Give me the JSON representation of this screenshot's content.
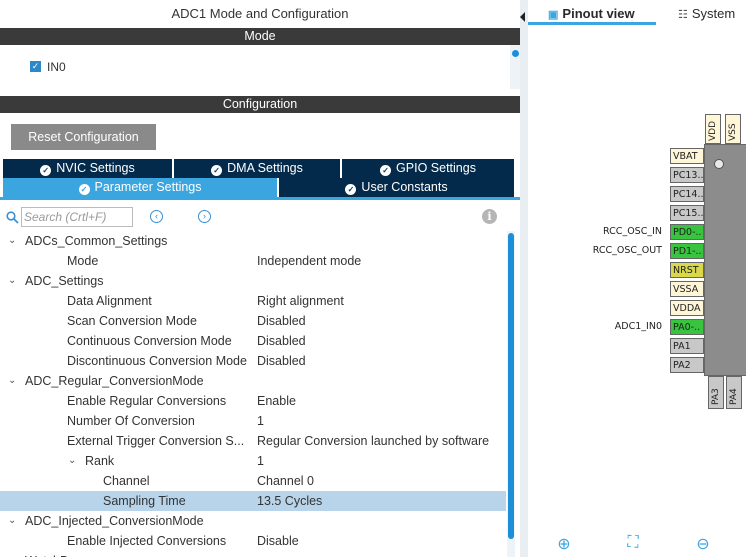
{
  "left": {
    "title": "ADC1 Mode and Configuration",
    "mode_header": "Mode",
    "mode_checkbox_label": "IN0",
    "config_header": "Configuration",
    "reset_button": "Reset Configuration",
    "tabs_row1": [
      "NVIC Settings",
      "DMA Settings",
      "GPIO Settings"
    ],
    "tabs_row2": [
      "Parameter Settings",
      "User Constants"
    ],
    "search_placeholder": "Search (Crtl+F)",
    "tree": [
      {
        "key": "ADCs_Common_Settings",
        "value": "",
        "level": 0,
        "chevron": true
      },
      {
        "key": "Mode",
        "value": "Independent mode",
        "level": 1
      },
      {
        "key": "ADC_Settings",
        "value": "",
        "level": 0,
        "chevron": true
      },
      {
        "key": "Data Alignment",
        "value": "Right alignment",
        "level": 1
      },
      {
        "key": "Scan Conversion Mode",
        "value": "Disabled",
        "level": 1
      },
      {
        "key": "Continuous Conversion Mode",
        "value": "Disabled",
        "level": 1
      },
      {
        "key": "Discontinuous Conversion Mode",
        "value": "Disabled",
        "level": 1
      },
      {
        "key": "ADC_Regular_ConversionMode",
        "value": "",
        "level": 0,
        "chevron": true
      },
      {
        "key": "Enable Regular Conversions",
        "value": "Enable",
        "level": 1
      },
      {
        "key": "Number Of Conversion",
        "value": "1",
        "level": 1
      },
      {
        "key": "External Trigger Conversion S...",
        "value": "Regular Conversion launched by software",
        "level": 1
      },
      {
        "key": "Rank",
        "value": "1",
        "level": 2,
        "chevron": true
      },
      {
        "key": "Channel",
        "value": "Channel 0",
        "level": 3
      },
      {
        "key": "Sampling Time",
        "value": "13.5 Cycles",
        "level": 3,
        "selected": true
      },
      {
        "key": "ADC_Injected_ConversionMode",
        "value": "",
        "level": 0,
        "chevron": true
      },
      {
        "key": "Enable Injected Conversions",
        "value": "Disable",
        "level": 1
      },
      {
        "key": "WatchDog",
        "value": "",
        "level": 0,
        "chevron": true
      }
    ]
  },
  "right": {
    "tab_pinout": "Pinout view",
    "tab_system": "System",
    "top_pins": [
      "VDD",
      "VSS"
    ],
    "left_pins": [
      {
        "label": "VBAT",
        "color": "#fff6d8"
      },
      {
        "label": "PC13..",
        "color": "#c8c8c8"
      },
      {
        "label": "PC14..",
        "color": "#c8c8c8"
      },
      {
        "label": "PC15..",
        "color": "#c8c8c8"
      },
      {
        "label": "PD0-..",
        "color": "#39c43f",
        "signal": "RCC_OSC_IN"
      },
      {
        "label": "PD1-..",
        "color": "#39c43f",
        "signal": "RCC_OSC_OUT"
      },
      {
        "label": "NRST",
        "color": "#d8d84a"
      },
      {
        "label": "VSSA",
        "color": "#fff6d8"
      },
      {
        "label": "VDDA",
        "color": "#fff6d8"
      },
      {
        "label": "PA0-..",
        "color": "#39c43f",
        "signal": "ADC1_IN0"
      },
      {
        "label": "PA1",
        "color": "#c8c8c8"
      },
      {
        "label": "PA2",
        "color": "#c8c8c8"
      }
    ],
    "bottom_pins": [
      "PA3",
      "PA4"
    ]
  }
}
